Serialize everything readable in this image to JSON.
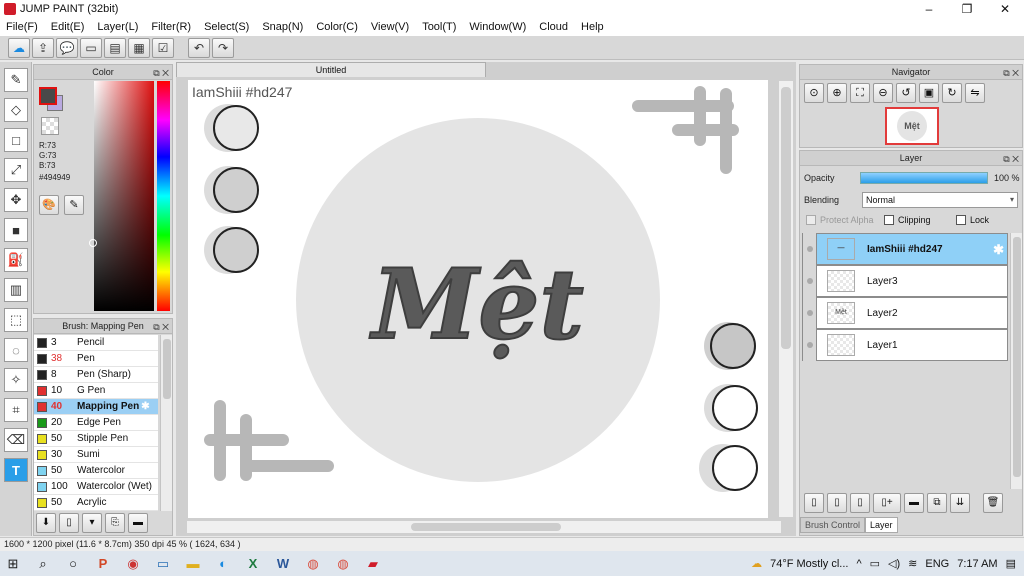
{
  "window": {
    "title": "JUMP PAINT (32bit)",
    "minimize": "–",
    "maximize": "❐",
    "close": "✕"
  },
  "menu": [
    "File(F)",
    "Edit(E)",
    "Layer(L)",
    "Filter(R)",
    "Select(S)",
    "Snap(N)",
    "Color(C)",
    "View(V)",
    "Tool(T)",
    "Window(W)",
    "Cloud",
    "Help"
  ],
  "toolbar": {
    "icons": [
      "cloud-icon",
      "share-icon",
      "comment-icon",
      "message-icon",
      "page-icon",
      "list-icon",
      "checklist-icon",
      "undo-icon",
      "redo-icon"
    ],
    "glyphs": [
      "☁",
      "⇪",
      "💬",
      "▭",
      "▤",
      "▦",
      "☑",
      "↶",
      "↷"
    ]
  },
  "tools": [
    {
      "name": "brush-tool",
      "glyph": "✎"
    },
    {
      "name": "eraser-tool",
      "glyph": "◇"
    },
    {
      "name": "rectangle-tool",
      "glyph": "□"
    },
    {
      "name": "eyedropper-tool",
      "glyph": "⤢"
    },
    {
      "name": "move-tool",
      "glyph": "✥"
    },
    {
      "name": "fill-rect-tool",
      "glyph": "■"
    },
    {
      "name": "bucket-tool",
      "glyph": "⛽"
    },
    {
      "name": "gradient-tool",
      "glyph": "▥"
    },
    {
      "name": "select-rect-tool",
      "glyph": "⬚"
    },
    {
      "name": "lasso-tool",
      "glyph": "◌"
    },
    {
      "name": "magic-wand-tool",
      "glyph": "✧"
    },
    {
      "name": "select-pen-tool",
      "glyph": "⌗"
    },
    {
      "name": "select-eraser-tool",
      "glyph": "⌫"
    },
    {
      "name": "text-tool",
      "glyph": "T"
    }
  ],
  "color_panel": {
    "title": "Color",
    "r": "R:73",
    "g": "G:73",
    "b": "B:73",
    "hex": "#494949",
    "main_color": "#494949"
  },
  "brush_panel": {
    "title": "Brush: Mapping Pen",
    "brushes": [
      {
        "size": "3",
        "name": "Pencil",
        "color": "#222222",
        "size_color": "#111111"
      },
      {
        "size": "38",
        "name": "Pen",
        "color": "#222222",
        "size_color": "#e03030"
      },
      {
        "size": "8",
        "name": "Pen (Sharp)",
        "color": "#222222",
        "size_color": "#111111"
      },
      {
        "size": "10",
        "name": "G Pen",
        "color": "#e03030",
        "size_color": "#111111"
      },
      {
        "size": "40",
        "name": "Mapping Pen",
        "color": "#e03030",
        "size_color": "#e03030",
        "selected": true
      },
      {
        "size": "20",
        "name": "Edge Pen",
        "color": "#1a9a1a",
        "size_color": "#111111"
      },
      {
        "size": "50",
        "name": "Stipple Pen",
        "color": "#e8e020",
        "size_color": "#111111"
      },
      {
        "size": "30",
        "name": "Sumi",
        "color": "#e8e020",
        "size_color": "#111111"
      },
      {
        "size": "50",
        "name": "Watercolor",
        "color": "#7fd3f0",
        "size_color": "#111111"
      },
      {
        "size": "100",
        "name": "Watercolor (Wet)",
        "color": "#7fd3f0",
        "size_color": "#111111"
      },
      {
        "size": "50",
        "name": "Acrylic",
        "color": "#e8e020",
        "size_color": "#111111"
      }
    ]
  },
  "canvas": {
    "tab_title": "Untitled",
    "signature": "IamShiii #hd247",
    "artwork_text": "Mệt"
  },
  "navigator": {
    "title": "Navigator",
    "icons": [
      "zoom-fit-icon",
      "zoom-in-icon",
      "fit-screen-icon",
      "zoom-out-icon",
      "rotate-left-icon",
      "actual-size-icon",
      "rotate-right-icon",
      "flip-icon"
    ],
    "glyphs": [
      "⊙",
      "⊕",
      "⛶",
      "⊖",
      "↺",
      "▣",
      "↻",
      "⇋"
    ]
  },
  "layer_panel": {
    "title": "Layer",
    "opacity_label": "Opacity",
    "opacity_value": "100 %",
    "blending_label": "Blending",
    "blending_value": "Normal",
    "protect_alpha": "Protect Alpha",
    "clipping": "Clipping",
    "lock": "Lock",
    "layers": [
      {
        "name": "IamShiii #hd247",
        "selected": true,
        "thumb": "—"
      },
      {
        "name": "Layer3",
        "thumb": ""
      },
      {
        "name": "Layer2",
        "thumb": "Mệt"
      },
      {
        "name": "Layer1",
        "thumb": ""
      }
    ],
    "tabs": [
      "Brush Control",
      "Layer"
    ]
  },
  "status": {
    "text": "1600 * 1200 pixel  (11.6 * 8.7cm)  350 dpi  45 %  ( 1624, 634 )"
  },
  "taskbar": {
    "weather": "74°F  Mostly cl...",
    "lang": "ENG",
    "time": "7:17 AM"
  }
}
